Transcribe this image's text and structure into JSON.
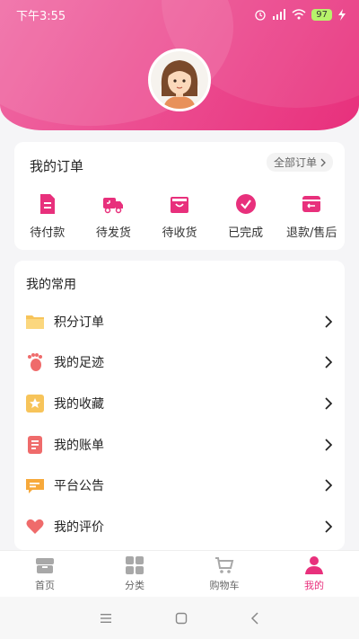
{
  "status_bar": {
    "time": "下午3:55",
    "battery": "97"
  },
  "orders": {
    "title": "我的订单",
    "all_label": "全部订单",
    "items": [
      {
        "label": "待付款",
        "icon": "document-icon"
      },
      {
        "label": "待发货",
        "icon": "truck-icon"
      },
      {
        "label": "待收货",
        "icon": "bag-icon"
      },
      {
        "label": "已完成",
        "icon": "check-circle-icon"
      },
      {
        "label": "退款/售后",
        "icon": "return-icon"
      }
    ]
  },
  "common": {
    "title": "我的常用",
    "items": [
      {
        "label": "积分订单",
        "icon": "folder-icon"
      },
      {
        "label": "我的足迹",
        "icon": "footprint-icon"
      },
      {
        "label": "我的收藏",
        "icon": "star-icon"
      },
      {
        "label": "我的账单",
        "icon": "bill-icon"
      },
      {
        "label": "平台公告",
        "icon": "message-icon"
      },
      {
        "label": "我的评价",
        "icon": "heart-icon"
      }
    ]
  },
  "tabbar": {
    "tabs": [
      {
        "label": "首页",
        "icon": "home-icon"
      },
      {
        "label": "分类",
        "icon": "grid-icon"
      },
      {
        "label": "购物车",
        "icon": "cart-icon"
      },
      {
        "label": "我的",
        "icon": "user-icon",
        "active": true
      }
    ]
  },
  "colors": {
    "accent": "#e8307c",
    "header": "#ec4f92"
  }
}
